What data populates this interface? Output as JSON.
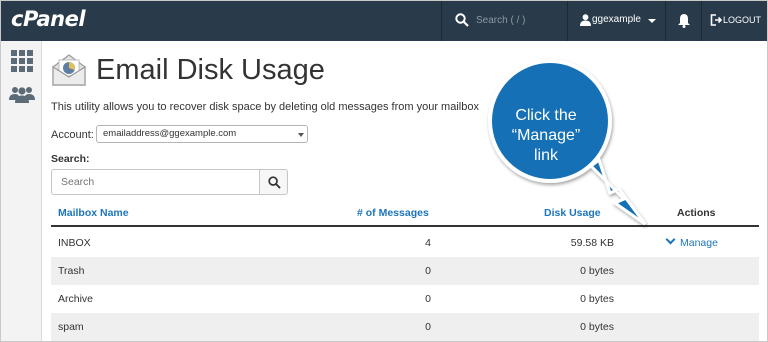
{
  "topbar": {
    "logo": "cPanel",
    "search_placeholder": "Search ( / )",
    "username": "ggexample",
    "logout_label": "LOGOUT"
  },
  "page": {
    "title": "Email Disk Usage",
    "description": "This utility allows you to recover disk space by deleting old messages from your mailbox"
  },
  "account": {
    "label": "Account:",
    "selected": "emailaddress@ggexample.com"
  },
  "search": {
    "label": "Search:",
    "placeholder": "Search"
  },
  "table": {
    "headers": {
      "name": "Mailbox Name",
      "messages": "# of Messages",
      "usage": "Disk Usage",
      "actions": "Actions"
    },
    "rows": [
      {
        "name": "INBOX",
        "messages": "4",
        "usage": "59.58 KB",
        "action": "Manage"
      },
      {
        "name": "Trash",
        "messages": "0",
        "usage": "0 bytes",
        "action": ""
      },
      {
        "name": "Archive",
        "messages": "0",
        "usage": "0 bytes",
        "action": ""
      },
      {
        "name": "spam",
        "messages": "0",
        "usage": "0 bytes",
        "action": ""
      }
    ]
  },
  "callout": {
    "line1": "Click the",
    "line2": "“Manage”",
    "line3": "link",
    "color": "#1570b5"
  },
  "colors": {
    "topbar": "#293a4a",
    "link": "#1c75bc"
  }
}
